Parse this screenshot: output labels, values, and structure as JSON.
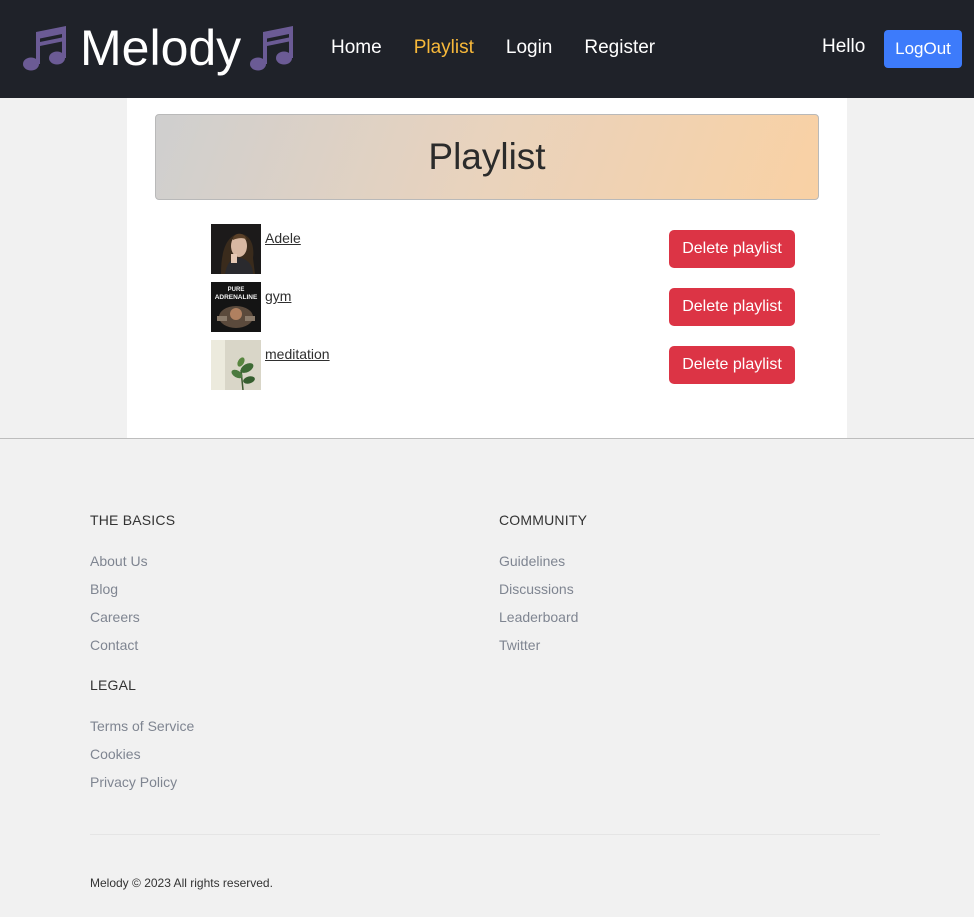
{
  "brand": {
    "name": "Melody",
    "logo_icon": "music-note-icon",
    "logo_color": "#6b5b95"
  },
  "nav": {
    "links": [
      {
        "label": "Home",
        "active": false
      },
      {
        "label": "Playlist",
        "active": true
      },
      {
        "label": "Login",
        "active": false
      },
      {
        "label": "Register",
        "active": false
      }
    ],
    "greeting": "Hello",
    "logout_label": "LogOut",
    "active_color": "#f8b93a",
    "logout_color": "#3d7bfb"
  },
  "main": {
    "title": "Playlist",
    "playlists": [
      {
        "name": "Adele",
        "thumb": "adele-portrait",
        "delete_label": "Delete playlist"
      },
      {
        "name": "gym",
        "thumb": "pure-adrenaline-cover",
        "thumb_text": [
          "PURE",
          "ADRENALINE"
        ],
        "delete_label": "Delete playlist"
      },
      {
        "name": "meditation",
        "thumb": "plant-leaves",
        "delete_label": "Delete playlist"
      }
    ],
    "delete_color": "#dc3445"
  },
  "footer": {
    "basics": {
      "heading": "THE BASICS",
      "links": [
        "About Us",
        "Blog",
        "Careers",
        "Contact"
      ]
    },
    "community": {
      "heading": "COMMUNITY",
      "links": [
        "Guidelines",
        "Discussions",
        "Leaderboard",
        "Twitter"
      ]
    },
    "legal": {
      "heading": "LEGAL",
      "links": [
        "Terms of Service",
        "Cookies",
        "Privacy Policy"
      ]
    },
    "copyright": "Melody © 2023 All rights reserved."
  }
}
